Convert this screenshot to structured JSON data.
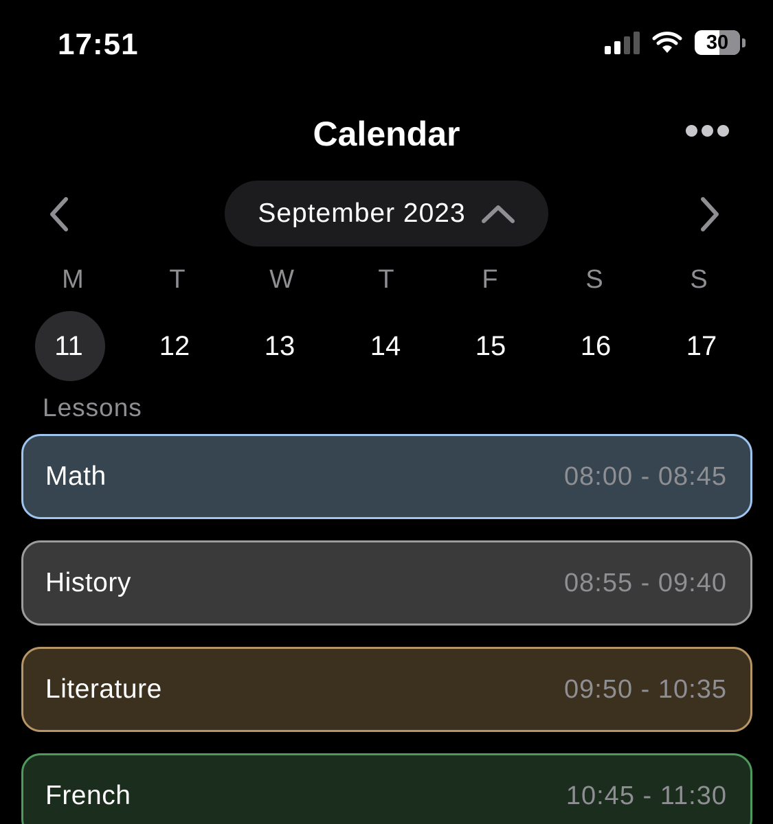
{
  "status_bar": {
    "time": "17:51",
    "battery": "30"
  },
  "header": {
    "title": "Calendar",
    "more_icon": "ellipsis-icon"
  },
  "month_nav": {
    "month": "September 2023",
    "prev_icon": "chevron-left-icon",
    "next_icon": "chevron-right-icon",
    "toggle_icon": "chevron-up-icon"
  },
  "week": {
    "weekdays": [
      "M",
      "T",
      "W",
      "T",
      "F",
      "S",
      "S"
    ],
    "days": [
      "11",
      "12",
      "13",
      "14",
      "15",
      "16",
      "17"
    ],
    "selected_day": "11"
  },
  "section_label": "Lessons",
  "lessons": [
    {
      "name": "Math",
      "time": "08:00 - 08:45",
      "bg": "#36454f",
      "border": "#9ec4f0"
    },
    {
      "name": "History",
      "time": "08:55 - 09:40",
      "bg": "#3a3a3a",
      "border": "#9c9c9c"
    },
    {
      "name": "Literature",
      "time": "09:50 - 10:35",
      "bg": "#3c311f",
      "border": "#b89565"
    },
    {
      "name": "French",
      "time": "10:45 - 11:30",
      "bg": "#1b2d1d",
      "border": "#4e9a5c"
    }
  ]
}
